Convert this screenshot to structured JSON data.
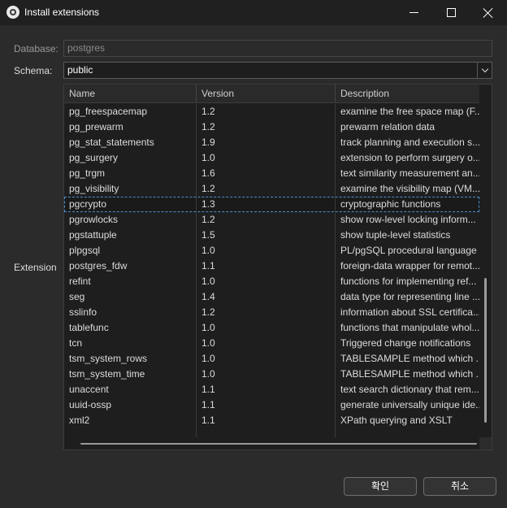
{
  "window": {
    "title": "Install extensions",
    "icon": "dbeaver-icon"
  },
  "form": {
    "database_label": "Database:",
    "database_value": "postgres",
    "schema_label": "Schema:",
    "schema_value": "public",
    "extension_label": "Extension"
  },
  "table": {
    "columns": [
      "Name",
      "Version",
      "Description"
    ],
    "rows": [
      {
        "name": "pg_freespacemap",
        "version": "1.2",
        "description": "examine the free space map (F..."
      },
      {
        "name": "pg_prewarm",
        "version": "1.2",
        "description": "prewarm relation data"
      },
      {
        "name": "pg_stat_statements",
        "version": "1.9",
        "description": "track planning and execution s..."
      },
      {
        "name": "pg_surgery",
        "version": "1.0",
        "description": "extension to perform surgery o..."
      },
      {
        "name": "pg_trgm",
        "version": "1.6",
        "description": "text similarity measurement an..."
      },
      {
        "name": "pg_visibility",
        "version": "1.2",
        "description": "examine the visibility map (VM..."
      },
      {
        "name": "pgcrypto",
        "version": "1.3",
        "description": "cryptographic functions"
      },
      {
        "name": "pgrowlocks",
        "version": "1.2",
        "description": "show row-level locking inform..."
      },
      {
        "name": "pgstattuple",
        "version": "1.5",
        "description": "show tuple-level statistics"
      },
      {
        "name": "plpgsql",
        "version": "1.0",
        "description": "PL/pgSQL procedural language"
      },
      {
        "name": "postgres_fdw",
        "version": "1.1",
        "description": "foreign-data wrapper for remot..."
      },
      {
        "name": "refint",
        "version": "1.0",
        "description": "functions for implementing ref..."
      },
      {
        "name": "seg",
        "version": "1.4",
        "description": "data type for representing line ..."
      },
      {
        "name": "sslinfo",
        "version": "1.2",
        "description": "information about SSL certifica..."
      },
      {
        "name": "tablefunc",
        "version": "1.0",
        "description": "functions that manipulate whol..."
      },
      {
        "name": "tcn",
        "version": "1.0",
        "description": "Triggered change notifications"
      },
      {
        "name": "tsm_system_rows",
        "version": "1.0",
        "description": "TABLESAMPLE method which ..."
      },
      {
        "name": "tsm_system_time",
        "version": "1.0",
        "description": "TABLESAMPLE method which ..."
      },
      {
        "name": "unaccent",
        "version": "1.1",
        "description": "text search dictionary that rem..."
      },
      {
        "name": "uuid-ossp",
        "version": "1.1",
        "description": "generate universally unique ide..."
      },
      {
        "name": "xml2",
        "version": "1.1",
        "description": "XPath querying and XSLT"
      }
    ],
    "selected_index": 6
  },
  "buttons": {
    "ok_label": "확인",
    "cancel_label": "취소"
  },
  "colors": {
    "background": "#2b2b2b",
    "titlebar": "#202020",
    "table_background": "#1e1e1e",
    "selection_outline": "#4d8fd6"
  }
}
